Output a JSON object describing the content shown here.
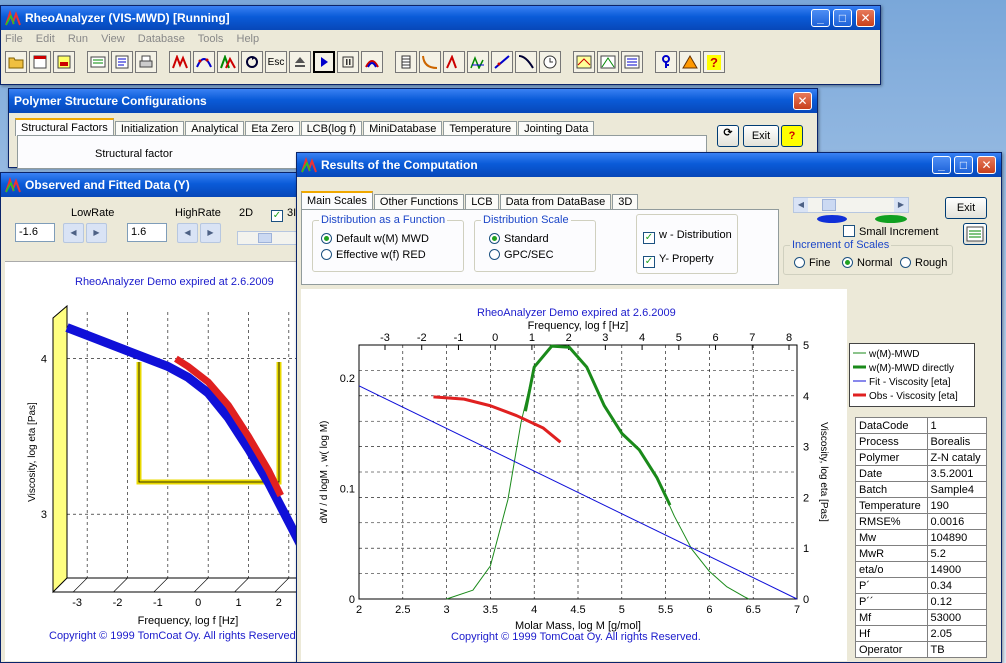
{
  "main_window": {
    "title": "RheoAnalyzer (VIS-MWD) [Running]",
    "menu": [
      "File",
      "Edit",
      "Run",
      "View",
      "Database",
      "Tools",
      "Help"
    ],
    "toolbar_esc_label": "Esc"
  },
  "structure_window": {
    "title": "Polymer Structure Configurations",
    "tabs": [
      "Structural Factors",
      "Initialization",
      "Analytical",
      "Eta Zero",
      "LCB(log f)",
      "MiniDatabase",
      "Temperature",
      "Jointing Data"
    ],
    "content_label": "Structural factor",
    "exit_label": "Exit",
    "help_label": "?"
  },
  "observed_window": {
    "title": "Observed and Fitted Data (Y)",
    "low_rate_label": "LowRate",
    "high_rate_label": "HighRate",
    "low_rate_value": "-1.6",
    "high_rate_value": "1.6",
    "mode_2d_label": "2D",
    "demo_notice": "RheoAnalyzer Demo expired at  2.6.2009",
    "copyright": "Copyright © 1999 TomCoat Oy. All rights Reserved.",
    "chart_data": {
      "type": "line",
      "title": "",
      "xlabel": "Frequency, log f [Hz]",
      "ylabel": "Viscosity, log eta [Pas]",
      "x_ticks": [
        "-3",
        "-2",
        "-1",
        "0",
        "1",
        "2"
      ],
      "y_ticks": [
        "4",
        "3"
      ],
      "xlim": [
        -3.5,
        2.5
      ],
      "ylim": [
        2.5,
        4.3
      ],
      "series": [
        {
          "name": "",
          "color": "#1010d8",
          "x": [
            -3.5,
            -3,
            -2,
            -1,
            -0.5,
            0,
            0.5,
            1,
            1.5,
            2,
            2.5
          ],
          "y": [
            4.2,
            4.15,
            4.05,
            3.95,
            3.88,
            3.78,
            3.62,
            3.42,
            3.2,
            2.95,
            2.7
          ]
        },
        {
          "name": "",
          "color": "#e02020",
          "x": [
            -0.8,
            -0.5,
            0,
            0.5,
            1,
            1.5,
            1.8
          ],
          "y": [
            4.0,
            3.95,
            3.85,
            3.7,
            3.5,
            3.28,
            3.12
          ]
        }
      ]
    }
  },
  "results_window": {
    "title": "Results of the Computation",
    "tabs": [
      "Main Scales",
      "Other Functions",
      "LCB",
      "Data from DataBase",
      "3D"
    ],
    "dist_func_group": "Distribution as a Function",
    "dist_func_opt1": "Default w(M)  MWD",
    "dist_func_opt2": "Effective w(f)  RED",
    "dist_scale_group": "Distribution Scale",
    "dist_scale_opt1": "Standard",
    "dist_scale_opt2": "GPC/SEC",
    "chk_w_distribution": "w - Distribution",
    "chk_y_property": "Y- Property",
    "small_increment": "Small Increment",
    "increment_group": "Increment of Scales",
    "inc_fine": "Fine",
    "inc_normal": "Normal",
    "inc_rough": "Rough",
    "exit_label": "Exit",
    "demo_notice": "RheoAnalyzer Demo expired at  2.6.2009",
    "copyright": "Copyright © 1999 TomCoat Oy. All rights Reserved.",
    "legend": [
      {
        "label": "w(M)-MWD",
        "color": "#1a8a1a",
        "width": 1
      },
      {
        "label": "w(M)-MWD directly",
        "color": "#1a8a1a",
        "width": 3
      },
      {
        "label": "Fit - Viscosity [eta]",
        "color": "#1010d8",
        "width": 1
      },
      {
        "label": "Obs - Viscosity [eta]",
        "color": "#e02020",
        "width": 3
      }
    ],
    "info_table": [
      [
        "DataCode",
        "1"
      ],
      [
        "Process",
        "Borealis"
      ],
      [
        "Polymer",
        "Z-N cataly"
      ],
      [
        "Date",
        "3.5.2001"
      ],
      [
        "Batch",
        "Sample4"
      ],
      [
        "Temperature",
        "190"
      ],
      [
        "RMSE%",
        "0.0016"
      ],
      [
        "Mw",
        "104890"
      ],
      [
        "MwR",
        "5.2"
      ],
      [
        "eta/o",
        "14900"
      ],
      [
        "P´",
        "0.34"
      ],
      [
        "P´´",
        "0.12"
      ],
      [
        "Mf",
        "53000"
      ],
      [
        "Hf",
        "2.05"
      ],
      [
        "Operator",
        "TB"
      ]
    ],
    "chart_data": {
      "type": "line",
      "title": "",
      "xlabel": "Molar Mass, log M [g/mol]",
      "x2label": "Frequency, log f [Hz]",
      "ylabel": "dW / d logM ,  w( log M)",
      "y2label": "Viscosity, log eta [Pas]",
      "xlim": [
        2,
        7
      ],
      "ylim": [
        0,
        0.23
      ],
      "x_ticks": [
        "2",
        "2.5",
        "3",
        "3.5",
        "4",
        "4.5",
        "5",
        "5.5",
        "6",
        "6.5",
        "7"
      ],
      "x2_ticks": [
        "-3",
        "-2",
        "-1",
        "0",
        "1",
        "2",
        "3",
        "4",
        "5",
        "6",
        "7",
        "8"
      ],
      "y_ticks": [
        "0",
        "0.1",
        "0.2"
      ],
      "y2_ticks": [
        "0",
        "1",
        "2",
        "3",
        "4",
        "5"
      ],
      "series": [
        {
          "name": "w(M)-MWD",
          "color": "#1a8a1a",
          "width": 1,
          "x": [
            3.0,
            3.3,
            3.5,
            3.7,
            3.85,
            4.0,
            4.2,
            4.4,
            4.6,
            4.8,
            5.0,
            5.2,
            5.4,
            5.6,
            5.8,
            6.0,
            6.2,
            6.4,
            6.45
          ],
          "y": [
            0.0,
            0.008,
            0.03,
            0.09,
            0.16,
            0.21,
            0.229,
            0.228,
            0.21,
            0.175,
            0.15,
            0.135,
            0.11,
            0.075,
            0.045,
            0.025,
            0.011,
            0.002,
            0.0
          ]
        },
        {
          "name": "w(M)-MWD directly",
          "color": "#1a8a1a",
          "width": 3,
          "x": [
            3.9,
            4.0,
            4.2,
            4.4,
            4.6,
            4.8,
            5.0,
            5.2,
            5.4,
            5.55
          ],
          "y": [
            0.17,
            0.21,
            0.229,
            0.228,
            0.21,
            0.175,
            0.15,
            0.135,
            0.11,
            0.085
          ]
        },
        {
          "name": "Fit - Viscosity [eta]",
          "color": "#1010d8",
          "width": 1,
          "x": [
            2.0,
            7.0
          ],
          "y": [
            0.193,
            0.0
          ]
        },
        {
          "name": "Obs - Viscosity [eta]",
          "color": "#e02020",
          "width": 3,
          "x": [
            2.85,
            3.2,
            3.5,
            3.8,
            4.1,
            4.3
          ],
          "y": [
            0.183,
            0.181,
            0.175,
            0.166,
            0.155,
            0.142
          ]
        }
      ]
    }
  }
}
